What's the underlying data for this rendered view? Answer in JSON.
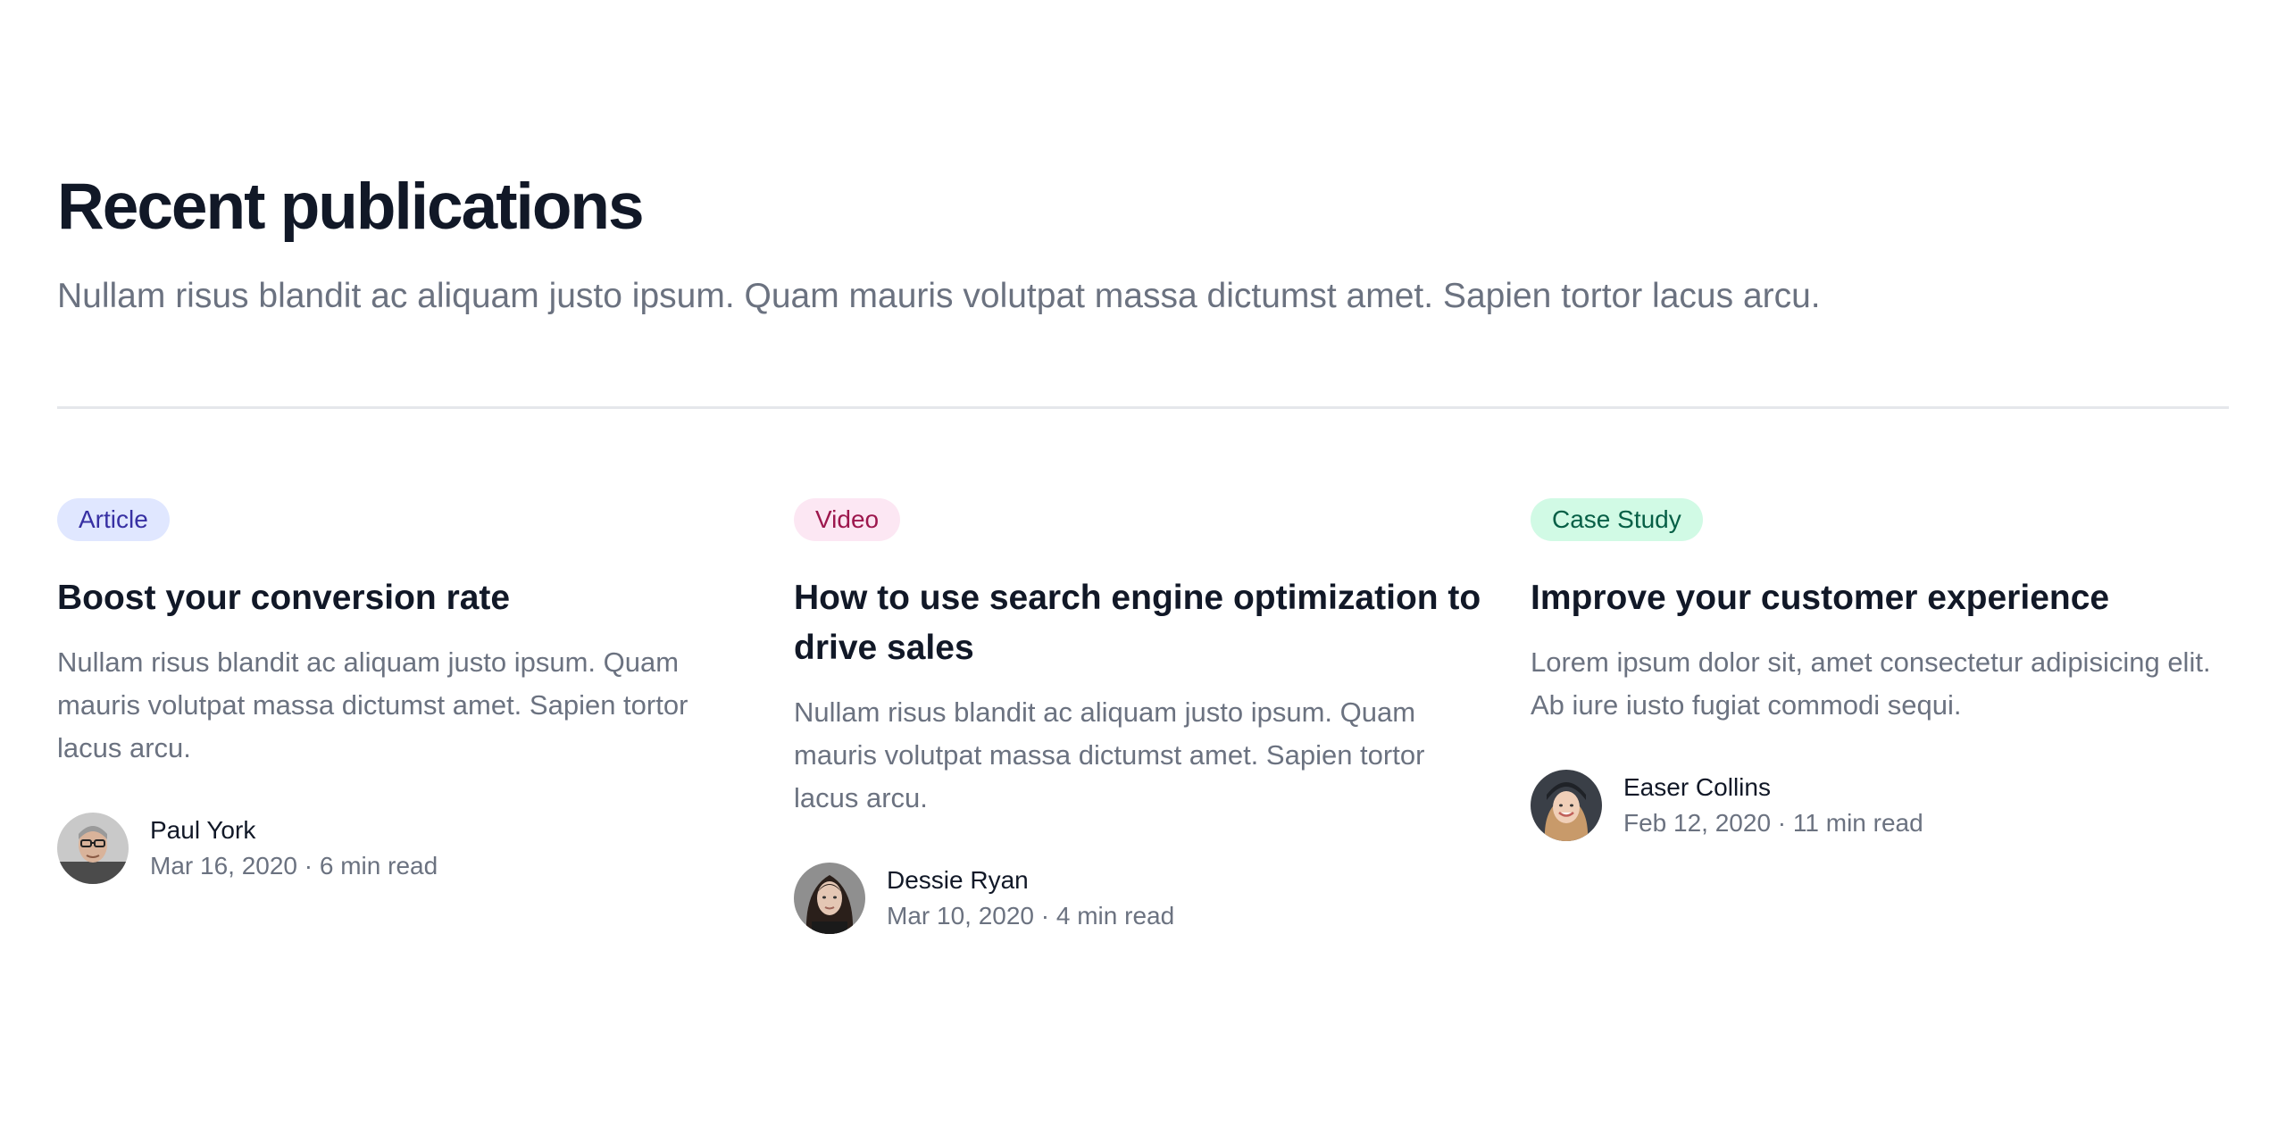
{
  "header": {
    "title": "Recent publications",
    "subtitle": "Nullam risus blandit ac aliquam justo ipsum. Quam mauris volutpat massa dictumst amet. Sapien tortor lacus arcu."
  },
  "posts": [
    {
      "category": "Article",
      "title": "Boost your conversion rate",
      "description": "Nullam risus blandit ac aliquam justo ipsum. Quam mauris volutpat massa dictumst amet. Sapien tortor lacus arcu.",
      "author": "Paul York",
      "meta": "Mar 16, 2020 · 6 min read"
    },
    {
      "category": "Video",
      "title": "How to use search engine optimization to drive sales",
      "description": "Nullam risus blandit ac aliquam justo ipsum. Quam mauris volutpat massa dictumst amet. Sapien tortor lacus arcu.",
      "author": "Dessie Ryan",
      "meta": "Mar 10, 2020 · 4 min read"
    },
    {
      "category": "Case Study",
      "title": "Improve your customer experience",
      "description": "Lorem ipsum dolor sit, amet consectetur adipisicing elit. Ab iure iusto fugiat commodi sequi.",
      "author": "Easer Collins",
      "meta": "Feb 12, 2020 · 11 min read"
    }
  ],
  "colors": {
    "article_badge_bg": "#e0e7ff",
    "article_badge_text": "#3730a3",
    "video_badge_bg": "#fce7f3",
    "video_badge_text": "#9d174d",
    "case_study_badge_bg": "#d1fae5",
    "case_study_badge_text": "#065f46"
  }
}
